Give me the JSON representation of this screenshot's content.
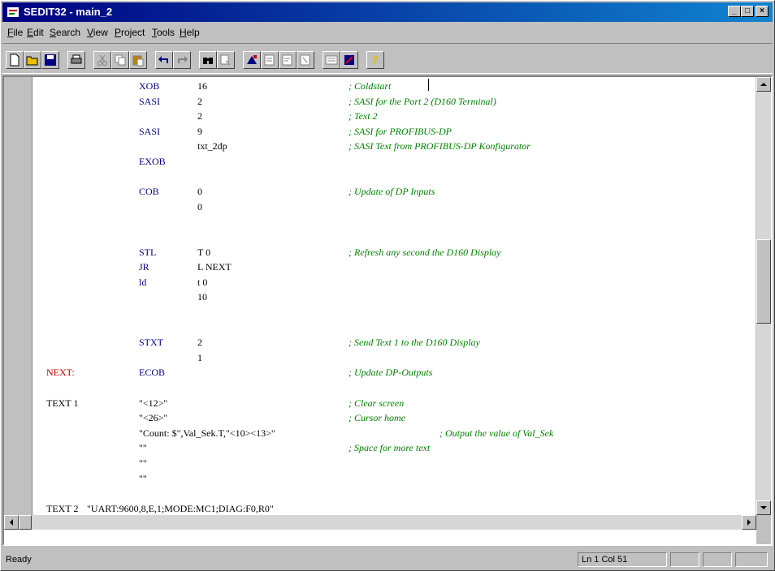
{
  "window": {
    "title": "SEDIT32 - main_2",
    "controls": [
      "minimize",
      "maximize",
      "close"
    ]
  },
  "menu": [
    "File",
    "Edit",
    "Search",
    "View",
    "Project",
    "Tools",
    "Help"
  ],
  "toolbar": [
    {
      "icon": "new-file-icon"
    },
    {
      "icon": "open-folder-icon"
    },
    {
      "icon": "save-icon"
    },
    {
      "icon": "print-icon"
    },
    {
      "icon": "cut-icon"
    },
    {
      "icon": "copy-icon"
    },
    {
      "icon": "paste-icon"
    },
    {
      "icon": "undo-icon"
    },
    {
      "icon": "redo-icon"
    },
    {
      "icon": "find-icon"
    },
    {
      "icon": "replace-icon"
    },
    {
      "icon": "build-icon"
    },
    {
      "icon": "compile-icon"
    },
    {
      "icon": "link-icon"
    },
    {
      "icon": "download-icon"
    },
    {
      "icon": "monitor-icon"
    },
    {
      "icon": "settings-icon"
    },
    {
      "icon": "help-icon"
    }
  ],
  "code": [
    {
      "label": "",
      "op": "XOB",
      "arg": "16",
      "comment": "; Coldstart"
    },
    {
      "label": "",
      "op": "SASI",
      "arg": "2",
      "comment": "; SASI for the Port 2 (D160 Terminal)"
    },
    {
      "label": "",
      "op": "",
      "arg": "2",
      "comment": "; Text 2"
    },
    {
      "label": "",
      "op": "SASI",
      "arg": "9",
      "comment": "; SASI for PROFIBUS-DP"
    },
    {
      "label": "",
      "op": "",
      "arg": "txt_2dp",
      "comment": "; SASI Text from PROFIBUS-DP Konfigurator"
    },
    {
      "label": "",
      "op": "EXOB",
      "arg": "",
      "comment": ""
    },
    {
      "label": "",
      "op": "",
      "arg": "",
      "comment": ""
    },
    {
      "label": "",
      "op": "COB",
      "arg": "0",
      "comment": "; Update of DP Inputs"
    },
    {
      "label": "",
      "op": "",
      "arg": "0",
      "comment": ""
    },
    {
      "label": "",
      "op": "",
      "arg": "",
      "comment": ""
    },
    {
      "label": "",
      "op": "",
      "arg": "",
      "comment": ""
    },
    {
      "label": "",
      "op": "STL",
      "arg": "T 0",
      "comment": "; Refresh any second the D160 Display"
    },
    {
      "label": "",
      "op": "JR",
      "arg": "L NEXT",
      "comment": ""
    },
    {
      "label": "",
      "op": "ld",
      "arg": "t 0",
      "comment": ""
    },
    {
      "label": "",
      "op": "",
      "arg": "10",
      "comment": ""
    },
    {
      "label": "",
      "op": "",
      "arg": "",
      "comment": ""
    },
    {
      "label": "",
      "op": "",
      "arg": "",
      "comment": ""
    },
    {
      "label": "",
      "op": "STXT",
      "arg": "2",
      "comment": "; Send Text 1 to the D160 Display"
    },
    {
      "label": "",
      "op": "",
      "arg": "1",
      "comment": ""
    },
    {
      "label": "NEXT:",
      "op": "ECOB",
      "arg": "",
      "comment": "; Update DP-Outputs"
    },
    {
      "label": "",
      "op": "",
      "arg": "",
      "comment": ""
    },
    {
      "label": "TEXT 1",
      "op": "\"<12>\"",
      "arg": "",
      "comment": "; Clear screen"
    },
    {
      "label": "",
      "op": "\"<26>\"",
      "arg": "",
      "comment": "; Cursor home"
    },
    {
      "label": "",
      "op": "\"Count: $\",Val_Sek.T,\"<10><13>\"",
      "arg": "",
      "comment": "; Output the value of Val_Sek"
    },
    {
      "label": "",
      "op": "\"\"",
      "arg": "",
      "comment": "; Space for more text"
    },
    {
      "label": "",
      "op": "\"\"",
      "arg": "",
      "comment": ""
    },
    {
      "label": "",
      "op": "\"\"",
      "arg": "",
      "comment": ""
    },
    {
      "label": "",
      "op": "",
      "arg": "",
      "comment": ""
    },
    {
      "label": "TEXT 2",
      "op": "\"UART:9600,8,E,1;MODE:MC1;DIAG:F0,R0\"",
      "arg": "",
      "comment": ""
    }
  ],
  "status": {
    "text": "Ready",
    "position": "Ln 1 Col 51"
  }
}
